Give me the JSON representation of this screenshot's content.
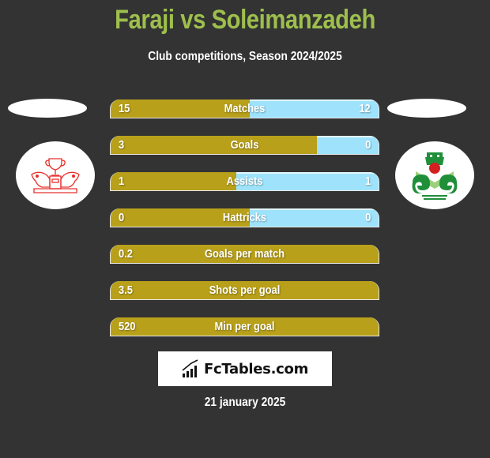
{
  "header": {
    "title": "Faraji vs Soleimanzadeh",
    "subtitle": "Club competitions, Season 2024/2025"
  },
  "colors": {
    "background": "#333333",
    "title": "#9ebf4d",
    "left_bar": "#b8a01a",
    "right_bar": "#9ee3fb"
  },
  "players": {
    "left": {
      "name": "Faraji",
      "club_logo_icon": "club-crest-trophy-lions-icon"
    },
    "right": {
      "name": "Soleimanzadeh",
      "club_logo_icon": "zob-ahan-crest-icon"
    }
  },
  "stats": [
    {
      "label": "Matches",
      "left": "15",
      "right": "12",
      "left_share": 0.52
    },
    {
      "label": "Goals",
      "left": "3",
      "right": "0",
      "left_share": 0.77
    },
    {
      "label": "Assists",
      "left": "1",
      "right": "1",
      "left_share": 0.47
    },
    {
      "label": "Hattricks",
      "left": "0",
      "right": "0",
      "left_share": 0.52
    },
    {
      "label": "Goals per match",
      "left": "0.2",
      "right": "",
      "left_share": 1
    },
    {
      "label": "Shots per goal",
      "left": "3.5",
      "right": "",
      "left_share": 1
    },
    {
      "label": "Min per goal",
      "left": "520",
      "right": "",
      "left_share": 1
    }
  ],
  "brand": {
    "name": "FcTables.com",
    "icon": "bar-chart-trend-icon"
  },
  "footer": {
    "date": "21 january 2025"
  }
}
